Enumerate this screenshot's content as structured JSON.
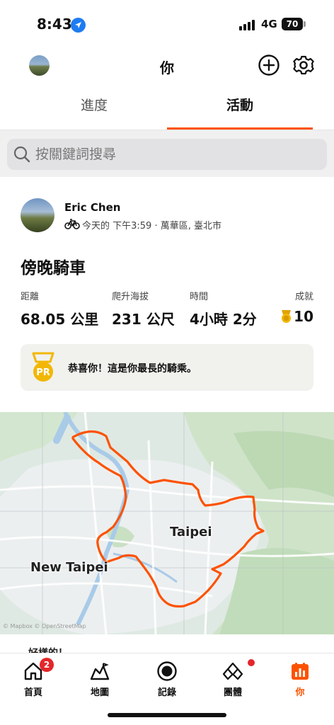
{
  "status_bar": {
    "time": "8:43",
    "network": "4G",
    "battery": "70"
  },
  "header": {
    "title": "你"
  },
  "tabs": [
    {
      "label": "進度",
      "active": false
    },
    {
      "label": "活動",
      "active": true
    }
  ],
  "search": {
    "placeholder": "按關鍵詞搜尋"
  },
  "activity": {
    "athlete": "Eric Chen",
    "meta": "今天的 下午3:59 · 萬華區, 臺北市",
    "title": "傍晚騎車",
    "stats": [
      {
        "label": "距離",
        "value": "68.05 公里"
      },
      {
        "label": "爬升海拔",
        "value": "231 公尺"
      },
      {
        "label": "時間",
        "value": "4小時 2分"
      },
      {
        "label": "成就",
        "value": "10"
      }
    ],
    "pr_message": "恭喜你！這是你最長的騎乘。",
    "pr_badge": "PR",
    "map": {
      "labels": [
        "Taipei",
        "New Taipei"
      ],
      "attribution": "© Mapbox © OpenStreetMap",
      "route_color": "#fc5200"
    },
    "kudos_text": "好樣的！"
  },
  "bottom_nav": [
    {
      "label": "首頁",
      "icon": "home-icon",
      "badge": "2"
    },
    {
      "label": "地圖",
      "icon": "map-icon"
    },
    {
      "label": "記錄",
      "icon": "record-icon"
    },
    {
      "label": "團體",
      "icon": "groups-icon",
      "dot": true
    },
    {
      "label": "你",
      "icon": "you-icon",
      "active": true
    }
  ],
  "colors": {
    "accent": "#fc5200",
    "badge_red": "#e4262a",
    "achievement_gold": "#f2b705"
  }
}
